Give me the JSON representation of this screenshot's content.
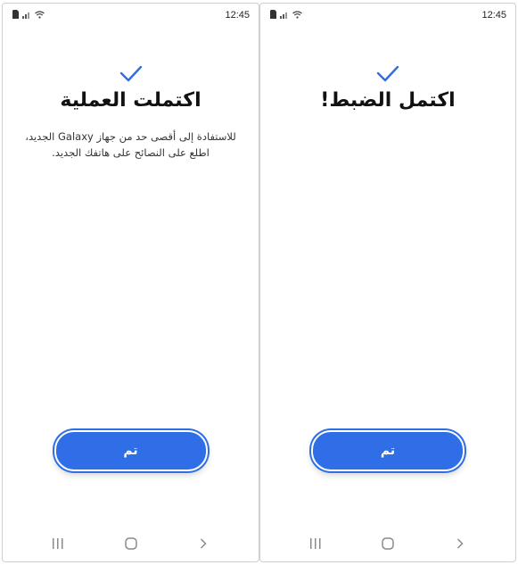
{
  "colors": {
    "accent": "#2f6ee6",
    "text": "#111111",
    "muted": "#333333",
    "nav": "#8a8a8a"
  },
  "screens": [
    {
      "status": {
        "time": "12:45"
      },
      "title": "اكتملت العملية",
      "subtitle": "للاستفادة إلى أقصى حد من جهاز Galaxy الجديد، اطلع على النصائح على هاتفك الجديد.",
      "button": "تم",
      "icons": {
        "check": "check-icon"
      }
    },
    {
      "status": {
        "time": "12:45"
      },
      "title": "اكتمل الضبط!",
      "subtitle": "",
      "button": "تم",
      "icons": {
        "check": "check-icon"
      }
    }
  ]
}
